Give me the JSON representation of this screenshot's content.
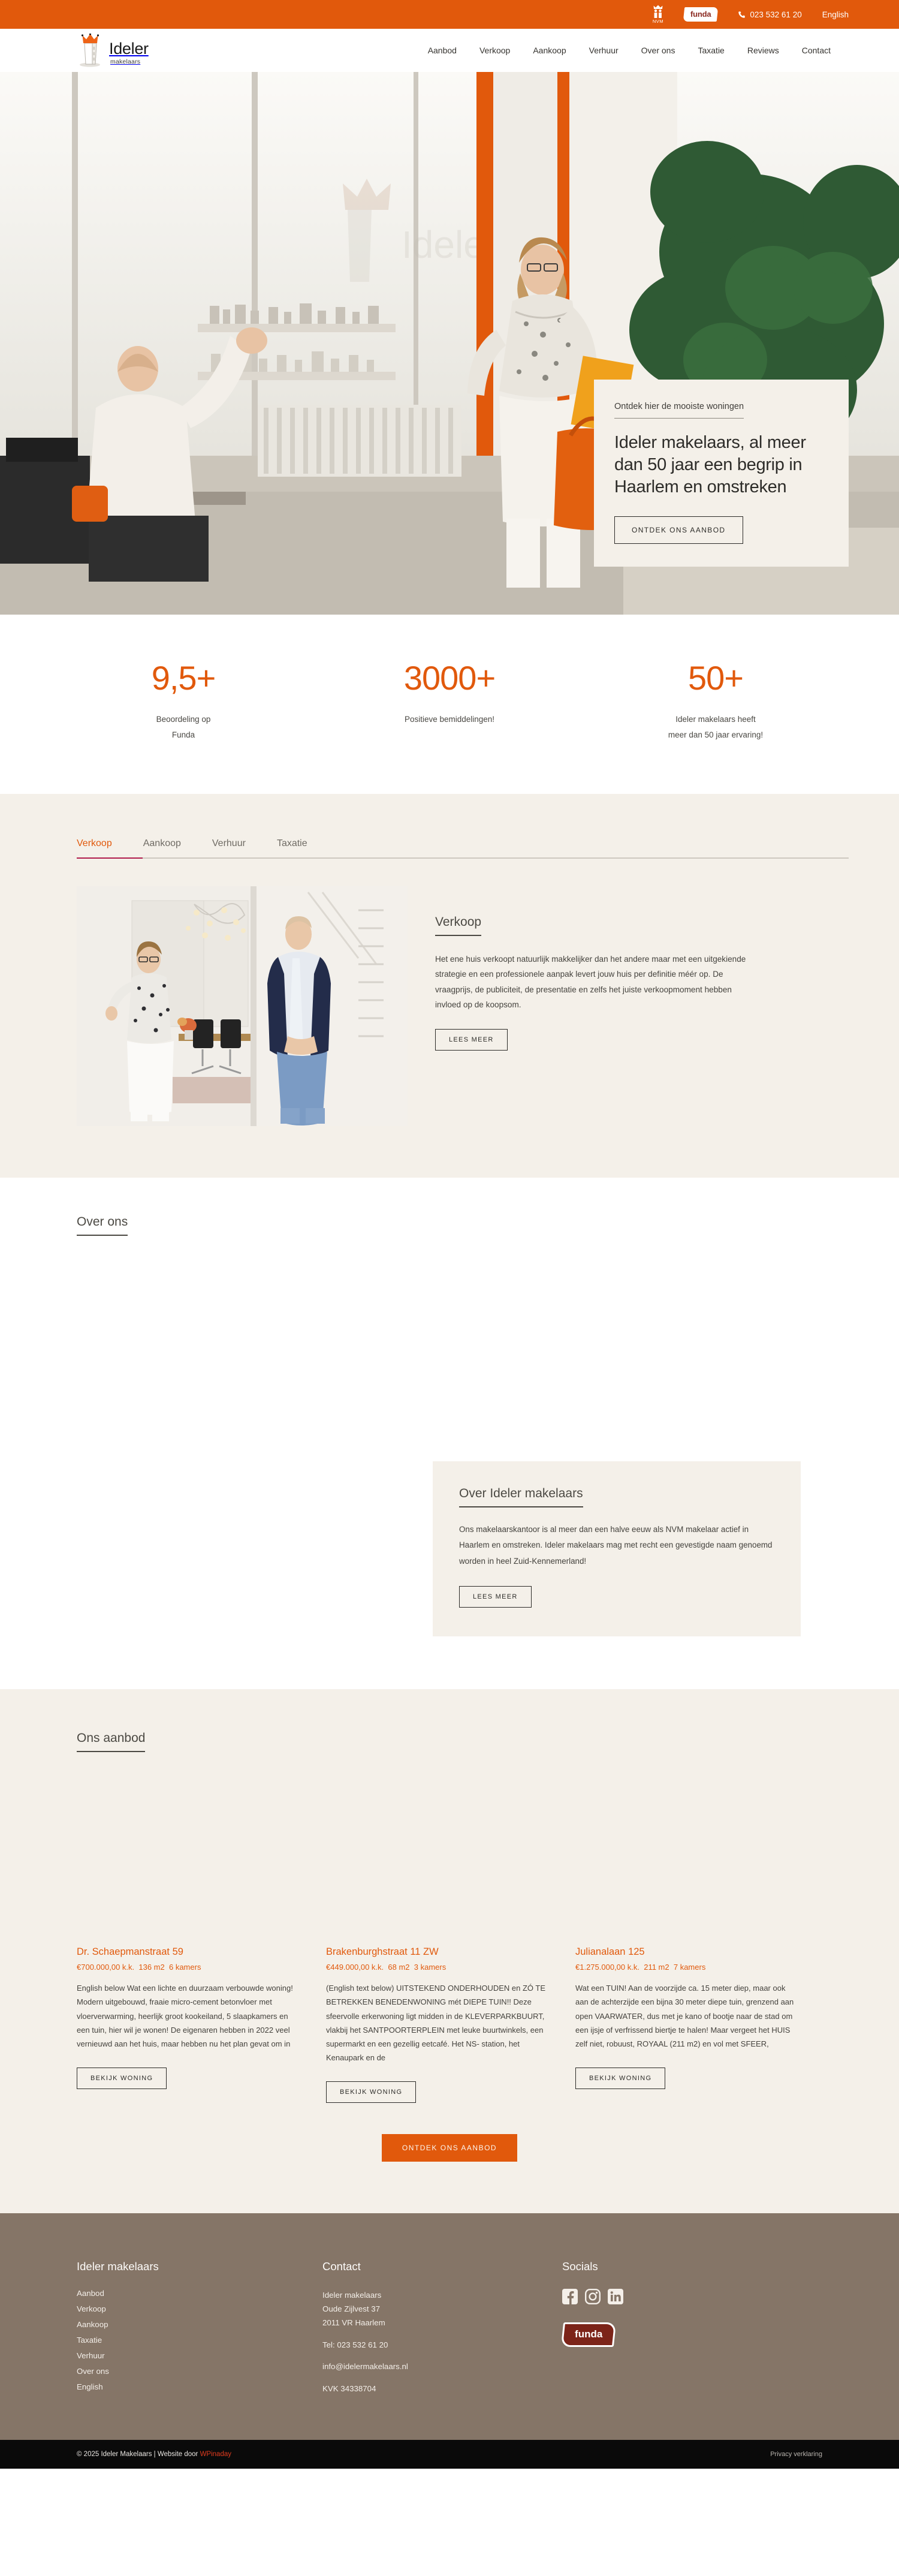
{
  "brand": {
    "accent": "#e1590c",
    "cream": "#f4f0e9",
    "footer_bg": "#857567"
  },
  "topbar": {
    "nvm_label": "NVM",
    "funda_label": "funda",
    "phone": "023 532 61 20",
    "language": "English"
  },
  "header": {
    "logo_name": "Ideler",
    "logo_sub": "makelaars",
    "nav": [
      {
        "label": "Aanbod"
      },
      {
        "label": "Verkoop"
      },
      {
        "label": "Aankoop"
      },
      {
        "label": "Verhuur"
      },
      {
        "label": "Over ons"
      },
      {
        "label": "Taxatie"
      },
      {
        "label": "Reviews"
      },
      {
        "label": "Contact"
      }
    ]
  },
  "hero": {
    "eyebrow": "Ontdek hier de mooiste woningen",
    "title": "Ideler makelaars, al meer dan 50 jaar een begrip in Haarlem en omstreken",
    "cta": "ONTDEK ONS AANBOD"
  },
  "stats": [
    {
      "value": "9,5+",
      "label": "Beoordeling op\nFunda"
    },
    {
      "value": "3000+",
      "label": "Positieve bemiddelingen!"
    },
    {
      "value": "50+",
      "label": "Ideler makelaars heeft\nmeer dan 50 jaar ervaring!"
    }
  ],
  "services": {
    "tabs": [
      {
        "label": "Verkoop",
        "active": true
      },
      {
        "label": "Aankoop",
        "active": false
      },
      {
        "label": "Verhuur",
        "active": false
      },
      {
        "label": "Taxatie",
        "active": false
      }
    ],
    "panel": {
      "heading": "Verkoop",
      "body": "Het ene huis verkoopt natuurlijk makkelijker dan het andere maar met een uitgekiende strategie en een professionele aanpak levert jouw huis per definitie méér op. De vraagprijs, de publiciteit, de presentatie en zelfs het juiste verkoopmoment hebben invloed op de koopsom.",
      "cta": "LEES MEER"
    }
  },
  "about": {
    "section_heading": "Over ons",
    "card_heading": "Over Ideler makelaars",
    "card_body": "Ons makelaarskantoor is al meer dan een halve eeuw als NVM makelaar actief in Haarlem en omstreken. Ideler makelaars mag met recht een gevestigde naam genoemd worden in heel Zuid-Kennemerland!",
    "cta": "LEES MEER"
  },
  "aanbod": {
    "heading": "Ons aanbod",
    "cta": "ONTDEK ONS AANBOD",
    "button_label": "BEKIJK WONING",
    "listings": [
      {
        "title": "Dr. Schaepmanstraat 59",
        "price": "€700.000,00 k.k.",
        "area": "136 m2",
        "rooms": "6 kamers",
        "description": "English below Wat een lichte en duurzaam verbouwde woning! Modern uitgebouwd, fraaie micro-cement betonvloer met vloerverwarming, heerlijk groot kookeiland, 5 slaapkamers en een tuin, hier wil je wonen! De eigenaren hebben in 2022 veel vernieuwd aan het huis, maar hebben nu het plan gevat om in"
      },
      {
        "title": "Brakenburghstraat 11 ZW",
        "price": "€449.000,00 k.k.",
        "area": "68 m2",
        "rooms": "3 kamers",
        "description": "(English text below) UITSTEKEND ONDERHOUDEN en ZÓ TE BETREKKEN BENEDENWONING mét DIEPE TUIN!! Deze sfeervolle erkerwoning ligt midden in de KLEVERPARKBUURT, vlakbij het SANTPOORTERPLEIN met leuke buurtwinkels, een supermarkt en een gezellig eetcafé. Het NS- station, het Kenaupark en de"
      },
      {
        "title": "Julianalaan 125",
        "price": "€1.275.000,00 k.k.",
        "area": "211 m2",
        "rooms": "7 kamers",
        "description": "Wat een TUIN! Aan de voorzijde ca. 15 meter diep, maar ook aan de achterzijde een bijna 30 meter diepe tuin, grenzend aan open VAARWATER, dus met je kano of bootje naar de stad om een ijsje of verfrissend biertje te halen! Maar vergeet het HUIS zelf niet, robuust, ROYAAL (211 m2) en vol met SFEER,"
      }
    ]
  },
  "footer": {
    "col1": {
      "heading": "Ideler makelaars",
      "links": [
        {
          "label": "Aanbod"
        },
        {
          "label": "Verkoop"
        },
        {
          "label": "Aankoop"
        },
        {
          "label": "Taxatie"
        },
        {
          "label": "Verhuur"
        },
        {
          "label": "Over ons"
        },
        {
          "label": "English"
        }
      ]
    },
    "col2": {
      "heading": "Contact",
      "name": "Ideler makelaars",
      "street": "Oude Zijlvest 37",
      "city": "2011 VR Haarlem",
      "phone": "Tel: 023 532 61 20",
      "email": "info@idelermakelaars.nl",
      "kvk": "KVK 34338704"
    },
    "col3": {
      "heading": "Socials",
      "funda_label": "funda"
    }
  },
  "bottombar": {
    "copyright_prefix": "© 2025 Ideler Makelaars | Website door ",
    "credit_link": "WPinaday",
    "privacy": "Privacy verklaring"
  }
}
